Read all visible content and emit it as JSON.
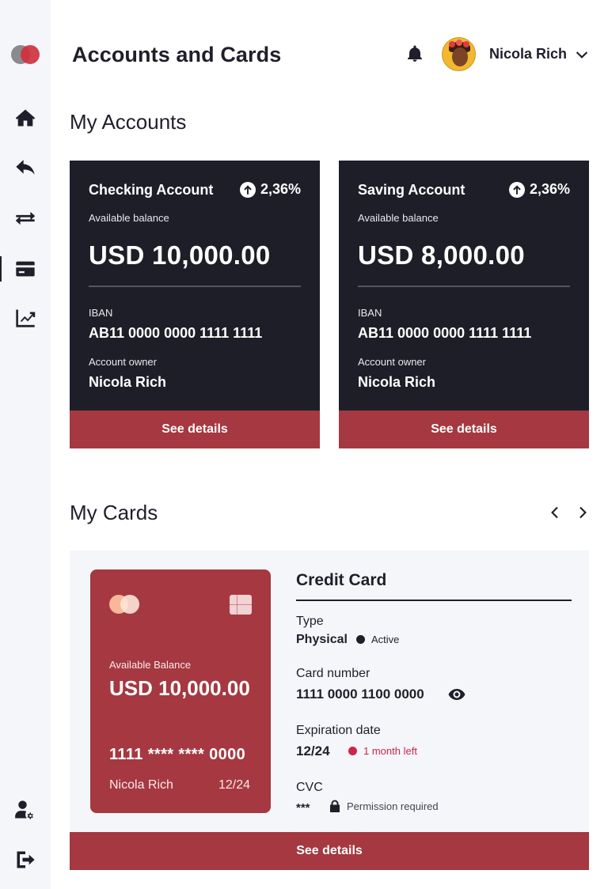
{
  "header": {
    "title": "Accounts and Cards",
    "user_name": "Nicola Rich"
  },
  "sidebar": {
    "items": [
      {
        "icon": "home-icon"
      },
      {
        "icon": "reply-icon"
      },
      {
        "icon": "transfer-icon"
      },
      {
        "icon": "credit-card-icon",
        "active": true
      },
      {
        "icon": "chart-line-icon"
      }
    ],
    "bottom_items": [
      {
        "icon": "user-settings-icon"
      },
      {
        "icon": "logout-icon"
      }
    ]
  },
  "accounts_section": {
    "title": "My Accounts",
    "accounts": [
      {
        "name": "Checking Account",
        "growth": "2,36%",
        "balance_label": "Available balance",
        "balance": "USD 10,000.00",
        "iban_label": "IBAN",
        "iban": "AB11 0000 0000 1111 1111",
        "owner_label": "Account owner",
        "owner": "Nicola Rich",
        "button": "See details"
      },
      {
        "name": "Saving Account",
        "growth": "2,36%",
        "balance_label": "Available balance",
        "balance": "USD 8,000.00",
        "iban_label": "IBAN",
        "iban": "AB11 0000 0000 1111 1111",
        "owner_label": "Account owner",
        "owner": "Nicola Rich",
        "button": "See details"
      }
    ]
  },
  "cards_section": {
    "title": "My Cards",
    "card": {
      "balance_label": "Available Balance",
      "balance": "USD 10,000.00",
      "masked_number": "1111 **** **** 0000",
      "holder": "Nicola Rich",
      "expiry": "12/24"
    },
    "details": {
      "title": "Credit Card",
      "type_label": "Type",
      "type_value": "Physical",
      "type_status": "Active",
      "number_label": "Card number",
      "number_value": "1111 0000 1100 0000",
      "expiration_label": "Expiration date",
      "expiration_value": "12/24",
      "expiration_note": "1 month left",
      "cvc_label": "CVC",
      "cvc_value": "***",
      "cvc_note": "Permission required"
    },
    "button": "See details"
  },
  "colors": {
    "accent": "#a53840",
    "dark_card": "#1e1e29",
    "sidebar": "#f5f6fa",
    "warning_dot": "#d0234a",
    "active_dot": "#1f1f2b"
  }
}
